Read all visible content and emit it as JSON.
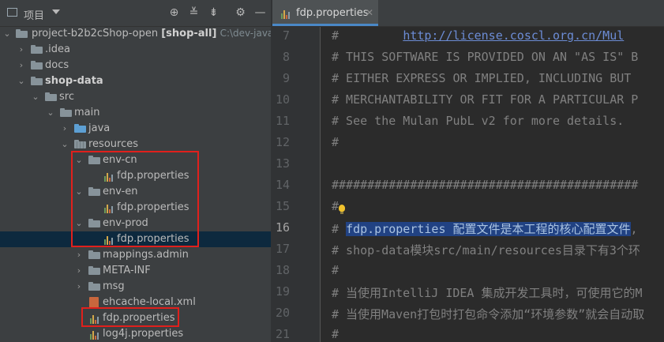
{
  "project_panel": {
    "title": "项目",
    "tree": [
      {
        "label": "project-b2b2cShop-open",
        "suffix": "[shop-all]",
        "path": "C:\\dev-java\\Ide"
      },
      {
        "label": ".idea"
      },
      {
        "label": "docs"
      },
      {
        "label": "shop-data"
      },
      {
        "label": "src"
      },
      {
        "label": "main"
      },
      {
        "label": "java"
      },
      {
        "label": "resources"
      },
      {
        "label": "env-cn"
      },
      {
        "label": "fdp.properties"
      },
      {
        "label": "env-en"
      },
      {
        "label": "fdp.properties"
      },
      {
        "label": "env-prod"
      },
      {
        "label": "fdp.properties"
      },
      {
        "label": "mappings.admin"
      },
      {
        "label": "META-INF"
      },
      {
        "label": "msg"
      },
      {
        "label": "ehcache-local.xml"
      },
      {
        "label": "fdp.properties"
      },
      {
        "label": "log4j.properties"
      }
    ]
  },
  "editor": {
    "tab": {
      "label": "fdp.properties"
    },
    "current_line": 16,
    "lines": [
      {
        "num": "7",
        "pre": "#         ",
        "link": "http://license.coscl.org.cn/Mul",
        "post": ""
      },
      {
        "num": "8",
        "text": "# THIS SOFTWARE IS PROVIDED ON AN \"AS IS\" B"
      },
      {
        "num": "9",
        "text": "# EITHER EXPRESS OR IMPLIED, INCLUDING BUT"
      },
      {
        "num": "10",
        "text": "# MERCHANTABILITY OR FIT FOR A PARTICULAR P"
      },
      {
        "num": "11",
        "text": "# See the Mulan PubL v2 for more details."
      },
      {
        "num": "12",
        "text": "#"
      },
      {
        "num": "13",
        "text": ""
      },
      {
        "num": "14",
        "text": "###########################################"
      },
      {
        "num": "15",
        "text": "#"
      },
      {
        "num": "16",
        "pre": "# ",
        "highlight": "fdp.properties 配置文件是本工程的核心配置文件",
        "post": ","
      },
      {
        "num": "17",
        "text": "# shop-data模块src/main/resources目录下有3个环"
      },
      {
        "num": "18",
        "text": "#"
      },
      {
        "num": "19",
        "text": "# 当使用IntelliJ IDEA 集成开发工具时，可使用它的M"
      },
      {
        "num": "20",
        "text": "# 当使用Maven打包时打包命令添加“环境参数”就会自动取"
      },
      {
        "num": "21",
        "text": "#"
      }
    ]
  },
  "colors": {
    "red_highlight_box": "#e0201c",
    "selection": "#214283",
    "accent": "#4a88c7"
  }
}
